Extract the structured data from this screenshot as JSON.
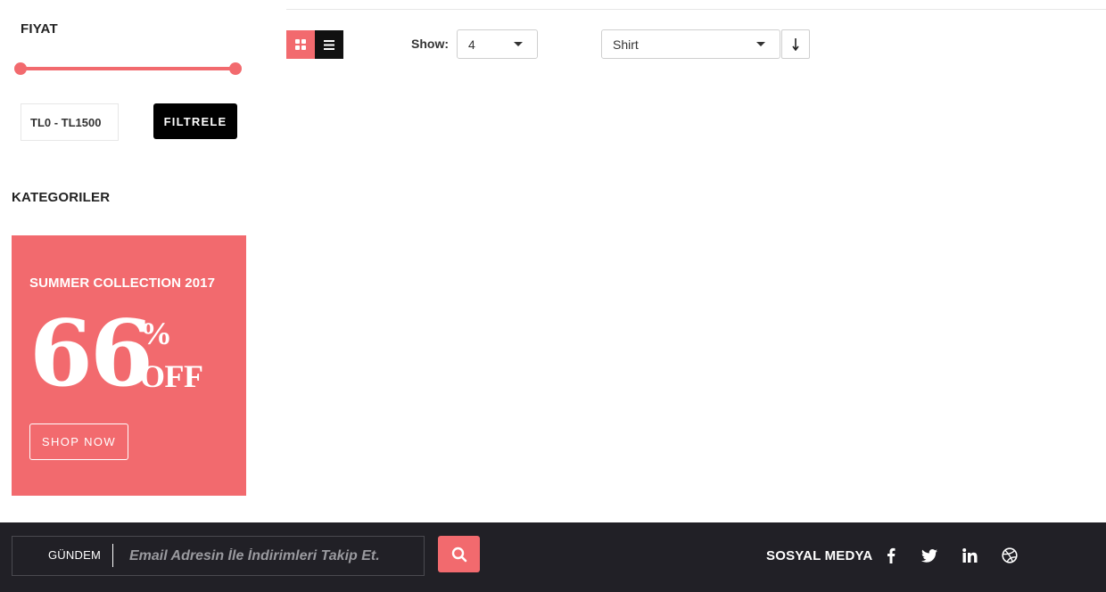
{
  "price_filter": {
    "title": "FIYAT",
    "range_text": "TL0 - TL1500",
    "filter_button": "FILTRELE"
  },
  "categories": {
    "title": "KATEGORILER"
  },
  "promo": {
    "title": "SUMMER COLLECTION 2017",
    "number": "66",
    "percent": "%",
    "off": "OFF",
    "button": "SHOP NOW",
    "color": "#f26a6e"
  },
  "toolbar": {
    "show_label": "Show:",
    "show_value": "4",
    "sort_value": "Shirt",
    "grid_icon": "grid-icon",
    "list_icon": "list-icon",
    "sort_icon": "arrow-down-icon"
  },
  "footer": {
    "newsletter_label": "GÜNDEM",
    "email_placeholder": "Email Adresin İle İndirimleri Takip Et.",
    "search_icon": "search-icon",
    "social_label": "SOSYAL MEDYA",
    "social_icons": [
      "facebook-icon",
      "twitter-icon",
      "linkedin-icon",
      "dribbble-icon"
    ],
    "background": "#212026"
  }
}
